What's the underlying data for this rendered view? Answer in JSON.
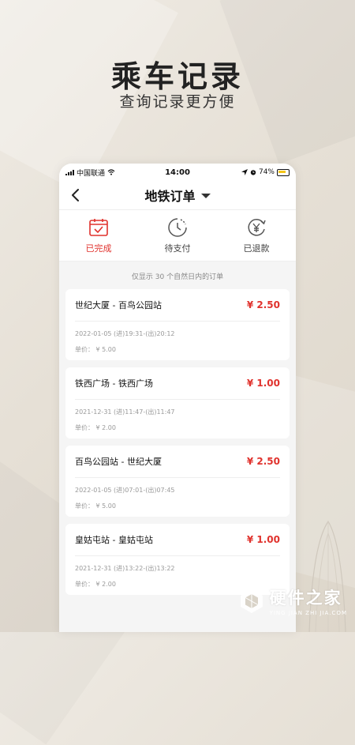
{
  "hero": {
    "title": "乘车记录",
    "subtitle": "查询记录更方便"
  },
  "status_bar": {
    "carrier": "中国联通",
    "time": "14:00",
    "battery": "74%"
  },
  "navbar": {
    "title": "地铁订单"
  },
  "tabs": [
    {
      "label": "已完成",
      "icon": "calendar-check-icon",
      "active": true
    },
    {
      "label": "待支付",
      "icon": "clock-icon",
      "active": false
    },
    {
      "label": "已退款",
      "icon": "yen-refund-icon",
      "active": false
    }
  ],
  "notice": "仅显示 30 个自然日内的订单",
  "orders": [
    {
      "route": "世纪大厦 - 百鸟公园站",
      "price": "¥ 2.50",
      "time": "2022-01-05 (进)19:31-(出)20:12",
      "unit_price": "单价： ¥ 5.00"
    },
    {
      "route": "铁西广场 - 铁西广场",
      "price": "¥ 1.00",
      "time": "2021-12-31 (进)11:47-(出)11:47",
      "unit_price": "单价： ¥ 2.00"
    },
    {
      "route": "百鸟公园站 - 世纪大厦",
      "price": "¥ 2.50",
      "time": "2022-01-05 (进)07:01-(出)07:45",
      "unit_price": "单价： ¥ 5.00"
    },
    {
      "route": "皇姑屯站 - 皇姑屯站",
      "price": "¥ 1.00",
      "time": "2021-12-31 (进)13:22-(出)13:22",
      "unit_price": "单价： ¥ 2.00"
    }
  ],
  "watermark": {
    "name": "硬件之家",
    "url": "YING JIAN ZHI JIA.COM"
  },
  "colors": {
    "accent": "#e0322d",
    "background": "#e9e4dc"
  }
}
